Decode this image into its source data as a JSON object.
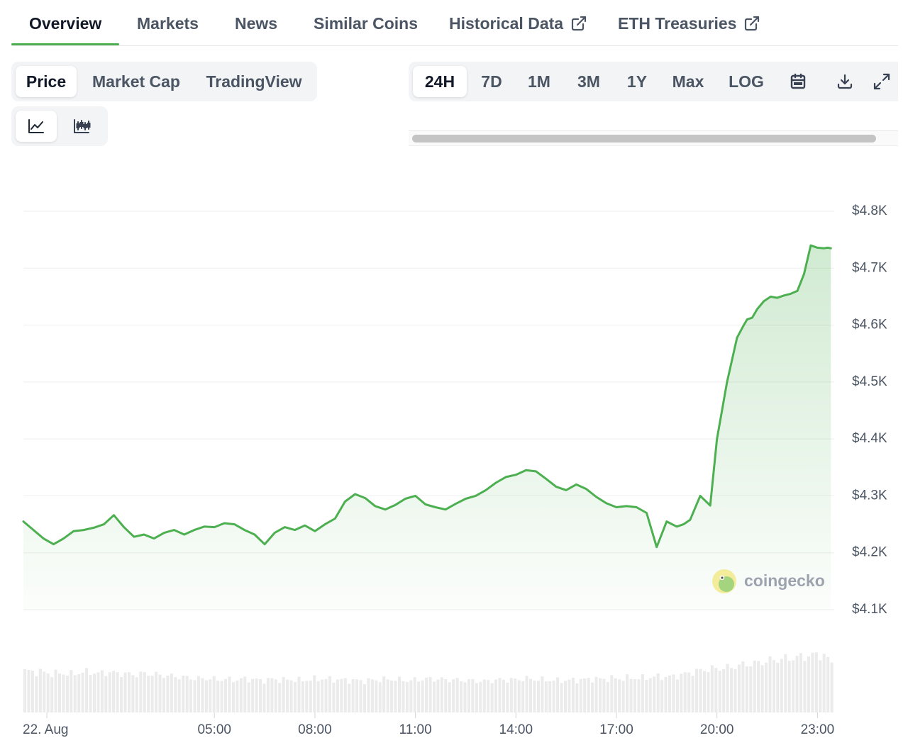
{
  "tabs": [
    {
      "label": "Overview",
      "active": true,
      "external": false
    },
    {
      "label": "Markets",
      "active": false,
      "external": false
    },
    {
      "label": "News",
      "active": false,
      "external": false
    },
    {
      "label": "Similar Coins",
      "active": false,
      "external": false
    },
    {
      "label": "Historical Data",
      "active": false,
      "external": true
    },
    {
      "label": "ETH Treasuries",
      "active": false,
      "external": true
    }
  ],
  "chart_tabs": [
    {
      "label": "Price",
      "active": true
    },
    {
      "label": "Market Cap",
      "active": false
    },
    {
      "label": "TradingView",
      "active": false
    }
  ],
  "chart_style": {
    "selected": "line",
    "icons": [
      "line-chart-icon",
      "candlestick-icon"
    ]
  },
  "time_ranges": [
    {
      "label": "24H",
      "active": true
    },
    {
      "label": "7D",
      "active": false
    },
    {
      "label": "1M",
      "active": false
    },
    {
      "label": "3M",
      "active": false
    },
    {
      "label": "1Y",
      "active": false
    },
    {
      "label": "Max",
      "active": false
    },
    {
      "label": "LOG",
      "active": false
    }
  ],
  "toolbar_icons": [
    "calendar-icon",
    "download-icon",
    "expand-icon"
  ],
  "watermark": {
    "text": "coingecko",
    "icon": "coingecko-logo-icon"
  },
  "colors": {
    "accent": "#4caf50",
    "line": "#4caf50",
    "fill": "#e3f2e4",
    "volume": "#ebebeb",
    "grid": "#eeeeee"
  },
  "chart_data": {
    "type": "line",
    "x_tick_labels": [
      "22. Aug",
      "05:00",
      "08:00",
      "11:00",
      "14:00",
      "17:00",
      "20:00",
      "23:00"
    ],
    "x_tick_hours": [
      0,
      5,
      8,
      11,
      14,
      17,
      20,
      23
    ],
    "x_range_hours": [
      -0.7,
      23.5
    ],
    "y_tick_labels": [
      "$4.8K",
      "$4.7K",
      "$4.6K",
      "$4.5K",
      "$4.4K",
      "$4.3K",
      "$4.2K",
      "$4.1K"
    ],
    "y_tick_values": [
      4800,
      4700,
      4600,
      4500,
      4400,
      4300,
      4200,
      4100
    ],
    "ylim": [
      4100,
      4810
    ],
    "grid": true,
    "series": [
      {
        "type": "price",
        "hours": [
          -0.7,
          -0.4,
          -0.1,
          0.2,
          0.5,
          0.8,
          1.1,
          1.4,
          1.7,
          2.0,
          2.3,
          2.6,
          2.9,
          3.2,
          3.5,
          3.8,
          4.1,
          4.4,
          4.7,
          5.0,
          5.3,
          5.6,
          5.9,
          6.2,
          6.5,
          6.8,
          7.1,
          7.4,
          7.7,
          8.0,
          8.3,
          8.6,
          8.9,
          9.2,
          9.5,
          9.8,
          10.1,
          10.4,
          10.7,
          11.0,
          11.3,
          11.6,
          11.9,
          12.2,
          12.5,
          12.8,
          13.1,
          13.4,
          13.7,
          14.0,
          14.3,
          14.6,
          14.9,
          15.2,
          15.5,
          15.8,
          16.1,
          16.4,
          16.7,
          17.0,
          17.3,
          17.6,
          17.9,
          18.2,
          18.5,
          18.8,
          19.0,
          19.2,
          19.5,
          19.8,
          20.0,
          20.3,
          20.6,
          20.8,
          20.9,
          21.05,
          21.2,
          21.4,
          21.6,
          21.8,
          22.0,
          22.2,
          22.4,
          22.6,
          22.8,
          23.0,
          23.2,
          23.3,
          23.4
        ],
        "values": [
          4255,
          4240,
          4225,
          4215,
          4225,
          4238,
          4240,
          4244,
          4250,
          4266,
          4245,
          4228,
          4232,
          4225,
          4235,
          4240,
          4232,
          4240,
          4246,
          4245,
          4252,
          4250,
          4240,
          4232,
          4215,
          4235,
          4245,
          4240,
          4248,
          4238,
          4250,
          4260,
          4290,
          4303,
          4296,
          4282,
          4276,
          4284,
          4295,
          4300,
          4285,
          4280,
          4276,
          4286,
          4295,
          4300,
          4310,
          4323,
          4333,
          4337,
          4345,
          4343,
          4330,
          4316,
          4310,
          4320,
          4312,
          4298,
          4287,
          4280,
          4282,
          4280,
          4270,
          4210,
          4255,
          4246,
          4250,
          4258,
          4300,
          4283,
          4400,
          4500,
          4578,
          4600,
          4610,
          4613,
          4628,
          4642,
          4650,
          4648,
          4652,
          4655,
          4660,
          4690,
          4740,
          4736,
          4735,
          4736,
          4735
        ],
        "line_width": 3
      },
      {
        "type": "volume",
        "relative_values": [
          0.92,
          0.9,
          0.89,
          0.85,
          0.87,
          0.84,
          0.88,
          0.9,
          0.86,
          0.89,
          0.87,
          0.85,
          0.83,
          0.86,
          0.84,
          0.82,
          0.8,
          0.78,
          0.76,
          0.74,
          0.75,
          0.72,
          0.73,
          0.71,
          0.74,
          0.72,
          0.7,
          0.73,
          0.71,
          0.72,
          0.7,
          0.72,
          0.74,
          0.73,
          0.72,
          0.71,
          0.7,
          0.69,
          0.71,
          0.72,
          0.73,
          0.71,
          0.7,
          0.72,
          0.74,
          0.73,
          0.72,
          0.71,
          0.7,
          0.69,
          0.68,
          0.7,
          0.72,
          0.71,
          0.73,
          0.74,
          0.72,
          0.71,
          0.7,
          0.7,
          0.71,
          0.72,
          0.74,
          0.73,
          0.75,
          0.74,
          0.76,
          0.75,
          0.77,
          0.79,
          0.78,
          0.8,
          0.85,
          0.9,
          0.94,
          0.97,
          0.98,
          1.0,
          1.05,
          1.08,
          1.1,
          1.15,
          1.18,
          1.2,
          1.22,
          1.25,
          1.28,
          1.3,
          1.1
        ]
      }
    ]
  }
}
